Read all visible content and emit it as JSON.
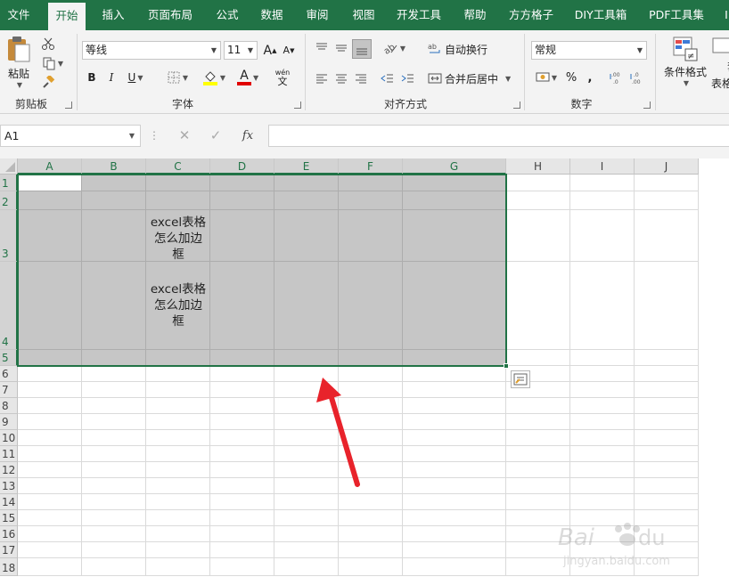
{
  "tabs": [
    {
      "label": "文件",
      "active": false
    },
    {
      "label": "开始",
      "active": true
    },
    {
      "label": "插入",
      "active": false
    },
    {
      "label": "页面布局",
      "active": false
    },
    {
      "label": "公式",
      "active": false
    },
    {
      "label": "数据",
      "active": false
    },
    {
      "label": "审阅",
      "active": false
    },
    {
      "label": "视图",
      "active": false
    },
    {
      "label": "开发工具",
      "active": false
    },
    {
      "label": "帮助",
      "active": false
    },
    {
      "label": "方方格子",
      "active": false
    },
    {
      "label": "DIY工具箱",
      "active": false
    },
    {
      "label": "PDF工具集",
      "active": false
    },
    {
      "label": "I",
      "active": false
    }
  ],
  "ribbon": {
    "clipboard": {
      "label": "剪贴板",
      "paste": "粘贴"
    },
    "font": {
      "label": "字体",
      "name": "等线",
      "size": "11",
      "grow": "A",
      "shrink": "A",
      "bold": "B",
      "italic": "I",
      "underline": "U",
      "font_color": "A",
      "phonetic": "wén"
    },
    "alignment": {
      "label": "对齐方式",
      "wrap": "自动换行",
      "merge": "合并后居中"
    },
    "number": {
      "label": "数字",
      "format": "常规",
      "percent": "%",
      "comma": ","
    },
    "styles": {
      "conditional": "条件格式",
      "table_partial_1": "套",
      "table_partial_2": "表格"
    }
  },
  "formula_bar": {
    "name_box": "A1",
    "cancel": "✕",
    "enter": "✓",
    "fx": "fx",
    "formula": ""
  },
  "sheet": {
    "columns": [
      "A",
      "B",
      "C",
      "D",
      "E",
      "F",
      "G",
      "H",
      "I",
      "J"
    ],
    "rows": [
      "1",
      "2",
      "3",
      "4",
      "5",
      "6",
      "7",
      "8",
      "9",
      "10",
      "11",
      "12",
      "13",
      "14",
      "15",
      "16",
      "17",
      "18"
    ],
    "cells": {
      "C3": "excel表格\n怎么加边\n框",
      "C4": "excel表格\n怎么加边\n框"
    },
    "selection": "A1:G5",
    "active_cell": "A1"
  },
  "colors": {
    "accent": "#217346",
    "selection_fill": "#c6c6c6",
    "arrow": "#e8232b"
  },
  "watermark": "Baidu经验 jingyan.baidu.com"
}
